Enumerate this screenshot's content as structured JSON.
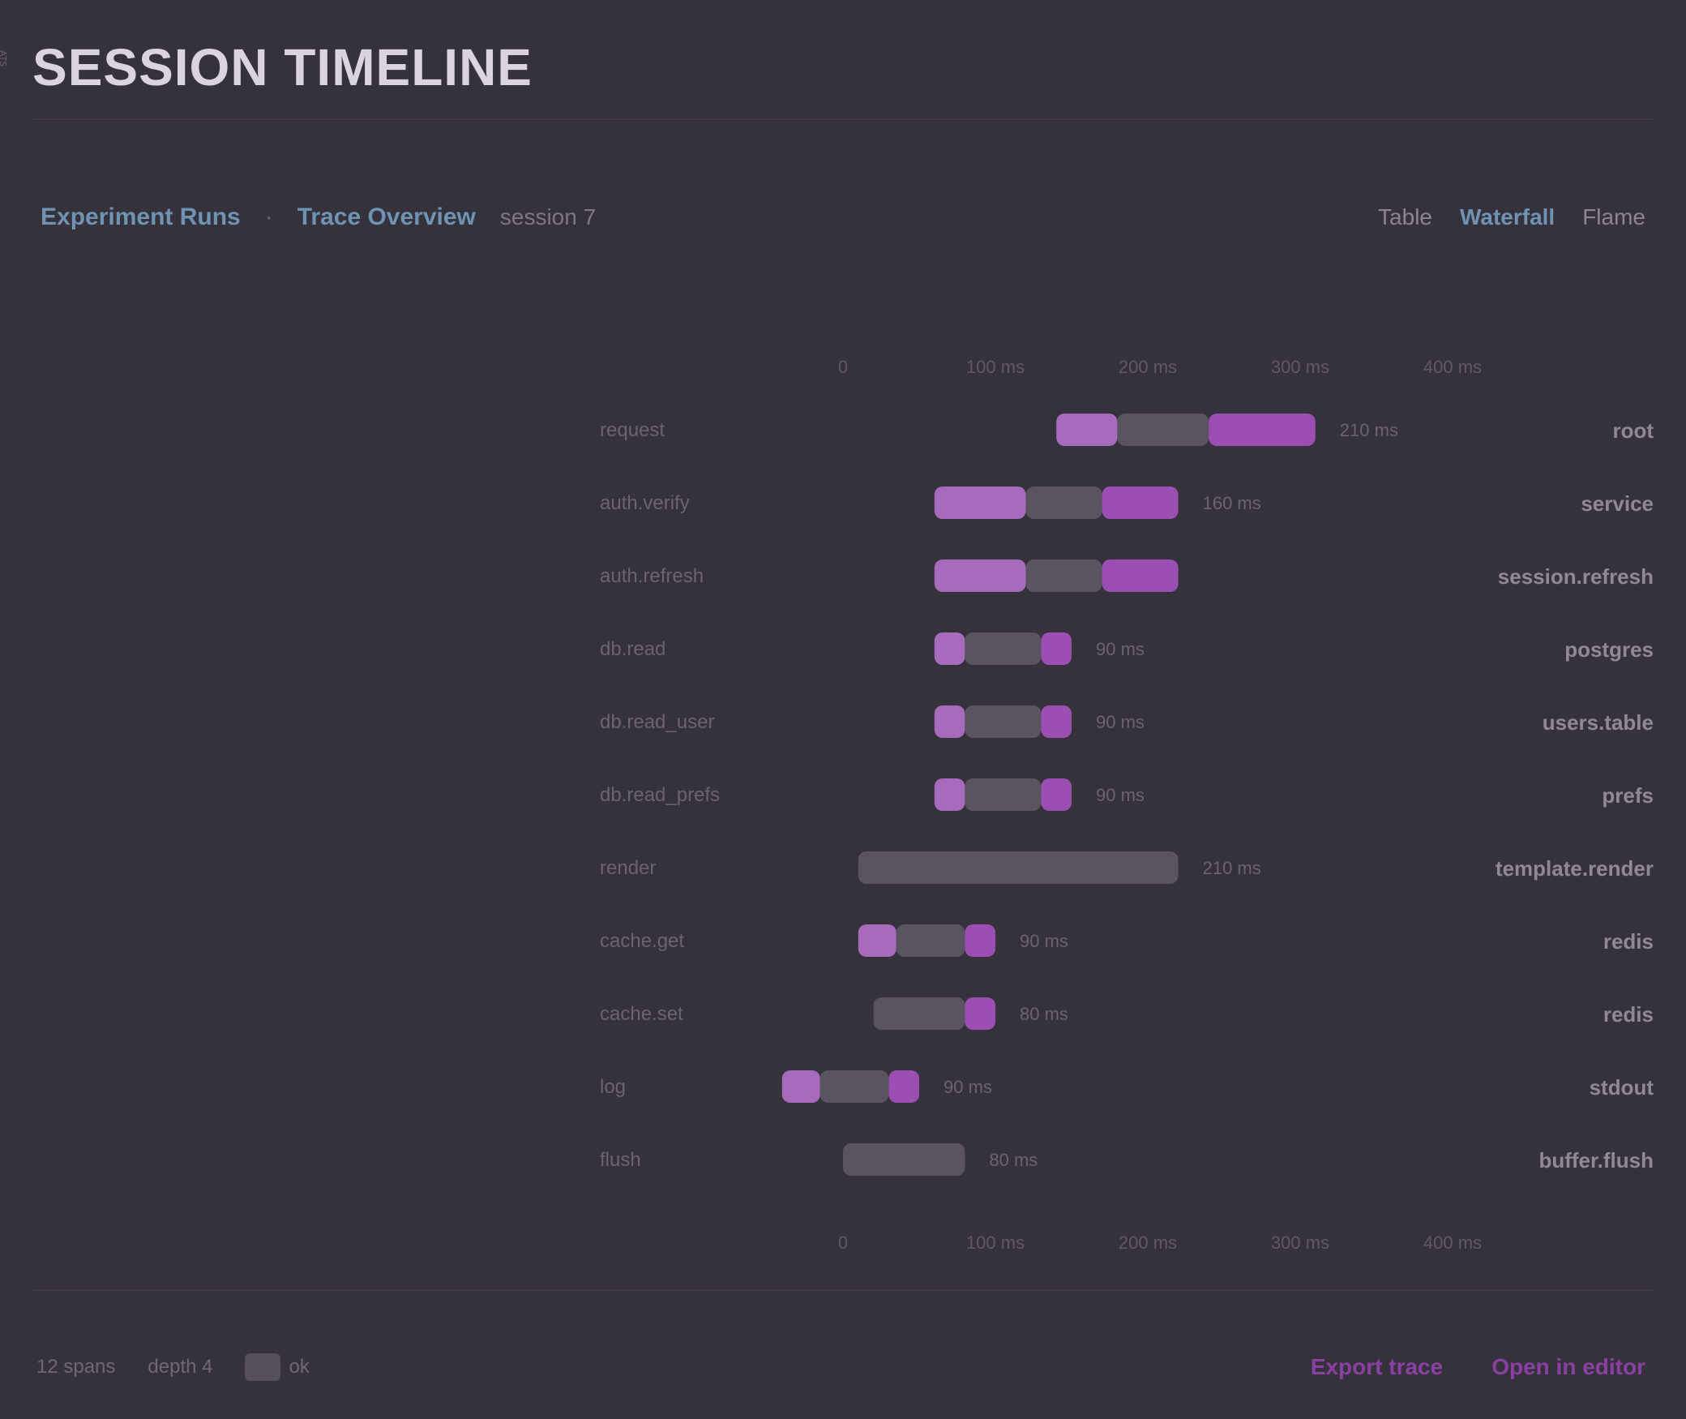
{
  "page": {
    "title": "SESSION TIMELINE",
    "side_mark": "ATS"
  },
  "breadcrumb": {
    "items": [
      "Experiment Runs",
      "Trace Overview"
    ],
    "current": "session 7"
  },
  "view_switch": {
    "options": [
      "Table",
      "Waterfall",
      "Flame"
    ],
    "active": "Waterfall"
  },
  "footer": {
    "left_text_1": "12 spans",
    "left_text_2": "depth 4",
    "badge_label": "ok",
    "links": [
      "Export trace",
      "Open in editor"
    ]
  },
  "colors": {
    "background": "#36323b",
    "accent_purple": "#9c4fb3",
    "accent_purple_light": "#a76bbe",
    "link_blue": "#6f93b3",
    "neutral_bar": "#5a5460",
    "footer_link": "#8a3fa3"
  },
  "chart_data": {
    "type": "bar",
    "subtype": "waterfall-timeline",
    "xlim": [
      0,
      500
    ],
    "xticks": [
      "0",
      "100 ms",
      "200 ms",
      "300 ms",
      "400 ms"
    ],
    "x_unit": "ms",
    "rows": [
      {
        "name": "request",
        "start": 40,
        "segments": [
          {
            "len": 40,
            "kind": "light"
          },
          {
            "len": 60,
            "kind": "neutral"
          },
          {
            "len": 70,
            "kind": "purple"
          }
        ],
        "duration_label": "210 ms",
        "right_label": "root"
      },
      {
        "name": "auth.verify",
        "start": -40,
        "segments": [
          {
            "len": 60,
            "kind": "light"
          },
          {
            "len": 50,
            "kind": "neutral"
          },
          {
            "len": 50,
            "kind": "purple"
          }
        ],
        "duration_label": "160 ms",
        "right_label": "service"
      },
      {
        "name": "auth.refresh",
        "start": -40,
        "segments": [
          {
            "len": 60,
            "kind": "light"
          },
          {
            "len": 50,
            "kind": "neutral"
          },
          {
            "len": 50,
            "kind": "purple"
          }
        ],
        "duration_label": "",
        "right_label": "session.refresh"
      },
      {
        "name": "db.read",
        "start": -40,
        "segments": [
          {
            "len": 20,
            "kind": "light"
          },
          {
            "len": 50,
            "kind": "neutral"
          },
          {
            "len": 20,
            "kind": "purple"
          }
        ],
        "duration_label": "90 ms",
        "right_label": "postgres"
      },
      {
        "name": "db.read_user",
        "start": -40,
        "segments": [
          {
            "len": 20,
            "kind": "light"
          },
          {
            "len": 50,
            "kind": "neutral"
          },
          {
            "len": 20,
            "kind": "purple"
          }
        ],
        "duration_label": "90 ms",
        "right_label": "users.table"
      },
      {
        "name": "db.read_prefs",
        "start": -40,
        "segments": [
          {
            "len": 20,
            "kind": "light"
          },
          {
            "len": 50,
            "kind": "neutral"
          },
          {
            "len": 20,
            "kind": "purple"
          }
        ],
        "duration_label": "90 ms",
        "right_label": "prefs"
      },
      {
        "name": "render",
        "start": -90,
        "segments": [
          {
            "len": 210,
            "kind": "neutral"
          }
        ],
        "duration_label": "210 ms",
        "right_label": "template.render"
      },
      {
        "name": "cache.get",
        "start": -90,
        "segments": [
          {
            "len": 25,
            "kind": "light"
          },
          {
            "len": 45,
            "kind": "neutral"
          },
          {
            "len": 20,
            "kind": "purple"
          }
        ],
        "duration_label": "90 ms",
        "right_label": "redis"
      },
      {
        "name": "cache.set",
        "start": -80,
        "segments": [
          {
            "len": 60,
            "kind": "neutral"
          },
          {
            "len": 20,
            "kind": "purple"
          }
        ],
        "duration_label": "80 ms",
        "right_label": "redis"
      },
      {
        "name": "log",
        "start": -140,
        "segments": [
          {
            "len": 25,
            "kind": "light"
          },
          {
            "len": 45,
            "kind": "neutral"
          },
          {
            "len": 20,
            "kind": "purple"
          }
        ],
        "duration_label": "90 ms",
        "right_label": "stdout"
      },
      {
        "name": "flush",
        "start": -100,
        "segments": [
          {
            "len": 80,
            "kind": "neutral"
          }
        ],
        "duration_label": "80 ms",
        "right_label": "buffer.flush"
      }
    ]
  }
}
